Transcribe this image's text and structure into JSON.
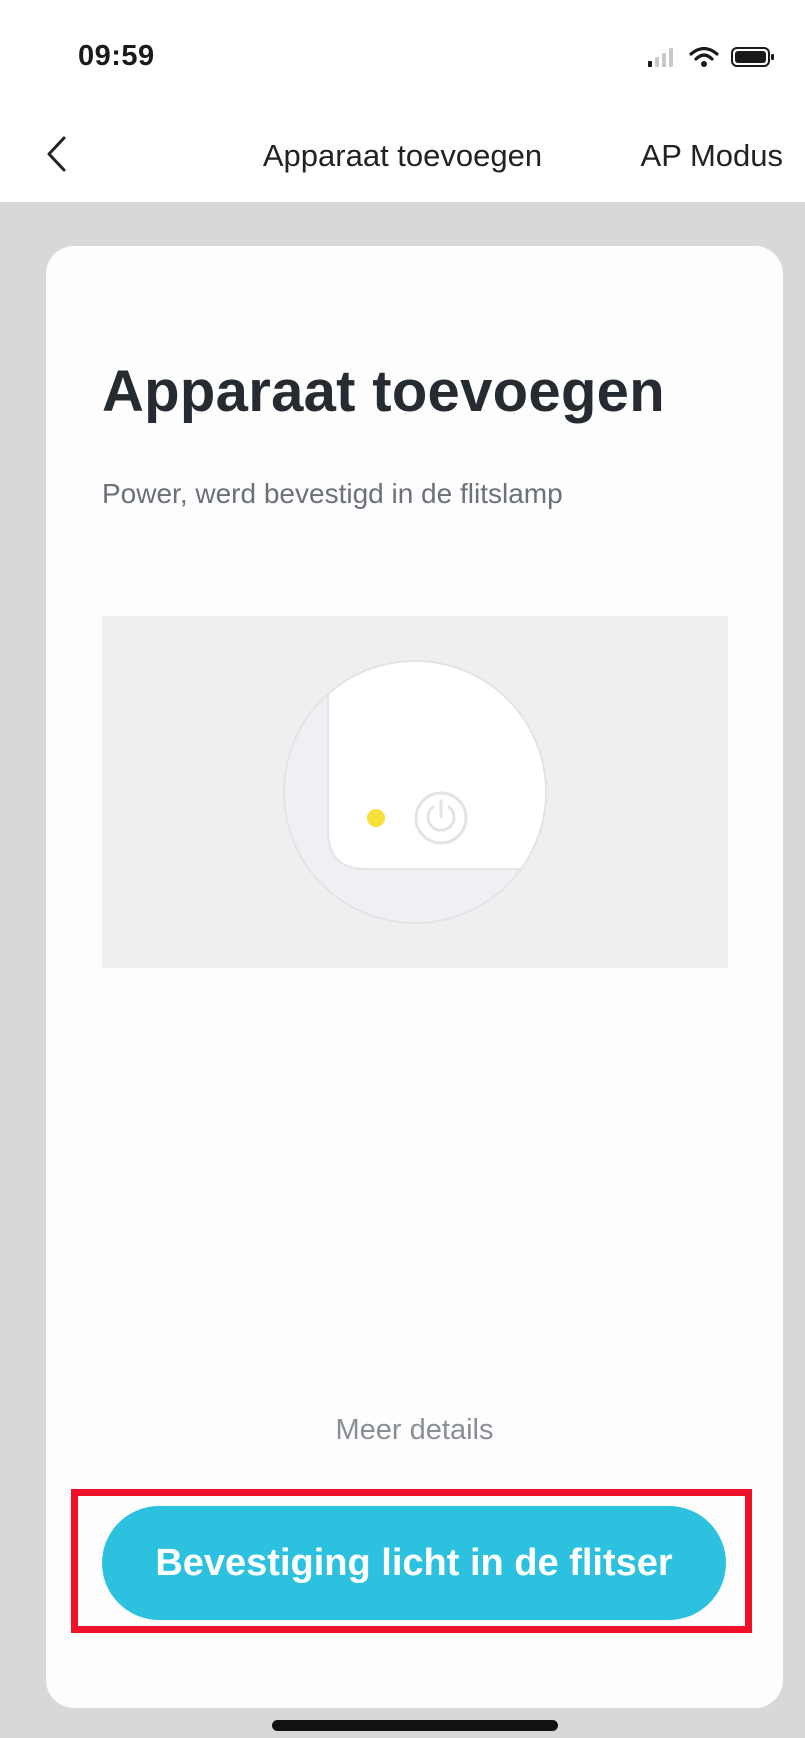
{
  "status": {
    "time": "09:59",
    "icons": [
      "signal-icon",
      "wifi-icon",
      "battery-icon"
    ]
  },
  "nav": {
    "back_icon": "chevron-left-icon",
    "title": "Apparaat toevoegen",
    "right_label": "AP Modus"
  },
  "card": {
    "title": "Apparaat toevoegen",
    "subtitle": "Power, werd bevestigd in de flitslamp",
    "illustration_icons": [
      "indicator-light-icon",
      "power-icon"
    ],
    "indicator_color": "#f7e13a",
    "details_link": "Meer details",
    "confirm_button": "Bevestiging licht in de flitser"
  },
  "colors": {
    "accent": "#2dc1e0",
    "highlight_frame": "#f0122b",
    "backdrop": "#d8d8d8"
  }
}
